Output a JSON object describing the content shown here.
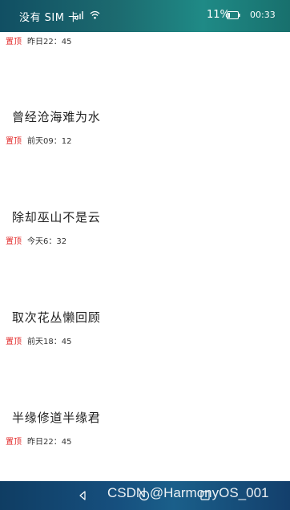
{
  "status_bar": {
    "carrier": "没有 SIM 卡",
    "battery": "11%",
    "time": "00:33"
  },
  "items": [
    {
      "title": "",
      "pin": "置顶",
      "time": "昨日22：45"
    },
    {
      "title": "曾经沧海难为水",
      "pin": "置顶",
      "time": "前天09：12"
    },
    {
      "title": "除却巫山不是云",
      "pin": "置顶",
      "time": "今天6：32"
    },
    {
      "title": "取次花丛懒回顾",
      "pin": "置顶",
      "time": "前天18：45"
    },
    {
      "title": "半缘修道半缘君",
      "pin": "置顶",
      "time": "昨日22：45"
    }
  ],
  "watermark": "CSDN @HarmonyOS_001",
  "colors": {
    "pin": "#e32b2b",
    "status_bar": "#1c6a6f",
    "nav_bar": "#164f7e"
  }
}
